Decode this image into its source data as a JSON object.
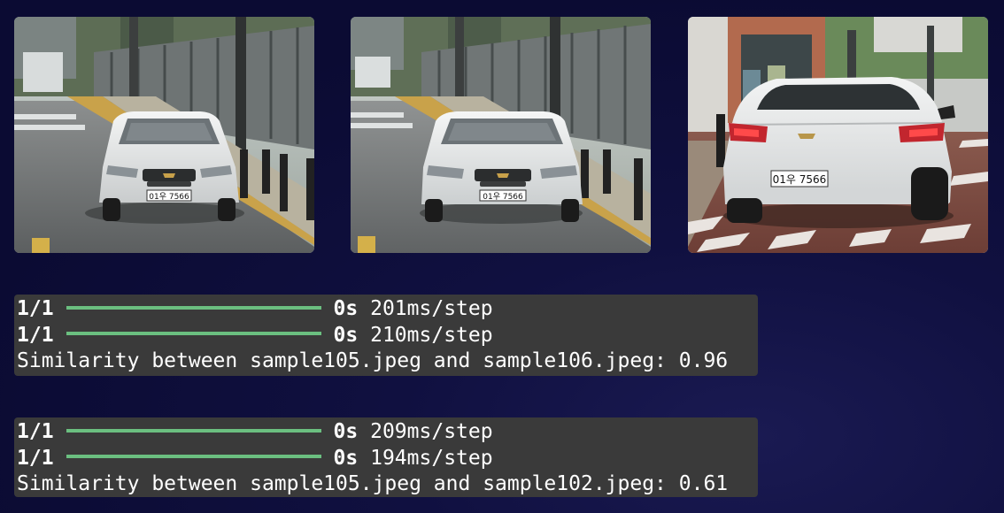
{
  "images": [
    {
      "plate": "01우 7566"
    },
    {
      "plate": "01우 7566"
    },
    {
      "plate": "01우 7566"
    }
  ],
  "outputs": [
    {
      "lines": [
        {
          "step": "1/1",
          "time": "0s",
          "rate": "201ms/step"
        },
        {
          "step": "1/1",
          "time": "0s",
          "rate": "210ms/step"
        }
      ],
      "result": "Similarity between sample105.jpeg and sample106.jpeg: 0.96"
    },
    {
      "lines": [
        {
          "step": "1/1",
          "time": "0s",
          "rate": "209ms/step"
        },
        {
          "step": "1/1",
          "time": "0s",
          "rate": "194ms/step"
        }
      ],
      "result": "Similarity between sample105.jpeg and sample102.jpeg: 0.61"
    }
  ],
  "progress_fraction": 1.0,
  "colors": {
    "background": "#0b0b33",
    "terminal_bg": "#3a3a3a",
    "progress_bar": "#6bbf80",
    "text": "#ffffff"
  }
}
